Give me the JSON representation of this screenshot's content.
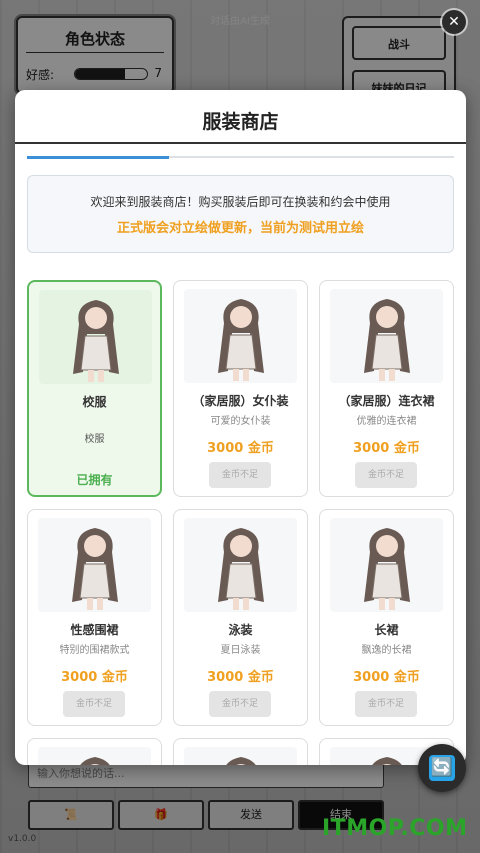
{
  "background": {
    "ai_note": "对话由AI生成",
    "status_title": "角色状态",
    "favor_label": "好感:",
    "favor_value": "7",
    "favor_fraction": 0.7,
    "battle_button": "战斗",
    "diary_button": "妹妹的日记",
    "chat_placeholder": "输入你想说的话...",
    "bottom_buttons": [
      "📜",
      "🎁",
      "发送",
      "结束"
    ],
    "version": "v1.0.0",
    "watermark": "ITMOP.COM"
  },
  "shop": {
    "title": "服装商店",
    "welcome": "欢迎来到服装商店！购买服装后即可在换装和约会中使用",
    "notice": "正式版会对立绘做更新，当前为测试用立绘",
    "items": [
      {
        "name": "校服",
        "desc": "校服",
        "owned": true,
        "owned_label": "已拥有"
      },
      {
        "name": "（家居服）女仆装",
        "desc": "可爱的女仆装",
        "price": "3000 金币",
        "button": "金币不足"
      },
      {
        "name": "（家居服）连衣裙",
        "desc": "优雅的连衣裙",
        "price": "3000 金币",
        "button": "金币不足"
      },
      {
        "name": "性感围裙",
        "desc": "特别的围裙款式",
        "price": "3000 金币",
        "button": "金币不足"
      },
      {
        "name": "泳装",
        "desc": "夏日泳装",
        "price": "3000 金币",
        "button": "金币不足"
      },
      {
        "name": "长裙",
        "desc": "飘逸的长裙",
        "price": "3000 金币",
        "button": "金币不足"
      }
    ],
    "close_symbol": "✕",
    "refresh_symbol": "🔄"
  },
  "colors": {
    "accent": "#3b8fd6",
    "price": "#f0a020",
    "owned": "#5cb85c"
  }
}
